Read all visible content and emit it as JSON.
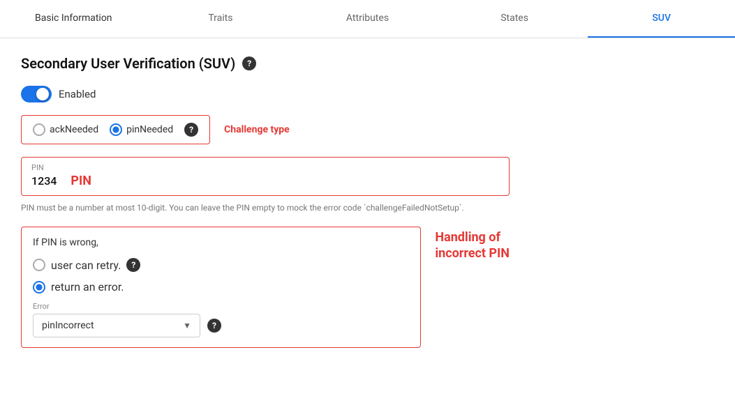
{
  "tabs": [
    {
      "id": "basic-information",
      "label": "Basic Information",
      "active": false
    },
    {
      "id": "traits",
      "label": "Traits",
      "active": false
    },
    {
      "id": "attributes",
      "label": "Attributes",
      "active": false
    },
    {
      "id": "states",
      "label": "States",
      "active": false
    },
    {
      "id": "suv",
      "label": "SUV",
      "active": true
    }
  ],
  "section": {
    "title": "Secondary User Verification (SUV)",
    "toggle_label": "Enabled",
    "challenge_type_label": "Challenge type",
    "challenge_options": [
      {
        "id": "ackNeeded",
        "label": "ackNeeded",
        "selected": false
      },
      {
        "id": "pinNeeded",
        "label": "pinNeeded",
        "selected": true
      }
    ],
    "pin_label": "PIN",
    "pin_value": "1234",
    "pin_display_label": "PIN",
    "pin_hint": "PIN must be a number at most 10-digit. You can leave the PIN empty to mock the error code `challengeFailedNotSetup`.",
    "incorrect_pin_title": "If PIN is wrong,",
    "incorrect_options": [
      {
        "id": "user-retry",
        "label": "user can retry.",
        "selected": false
      },
      {
        "id": "return-error",
        "label": "return an error.",
        "selected": true
      }
    ],
    "error_label": "Error",
    "error_value": "pinIncorrect",
    "handling_label": "Handling of\nincorrect PIN"
  }
}
